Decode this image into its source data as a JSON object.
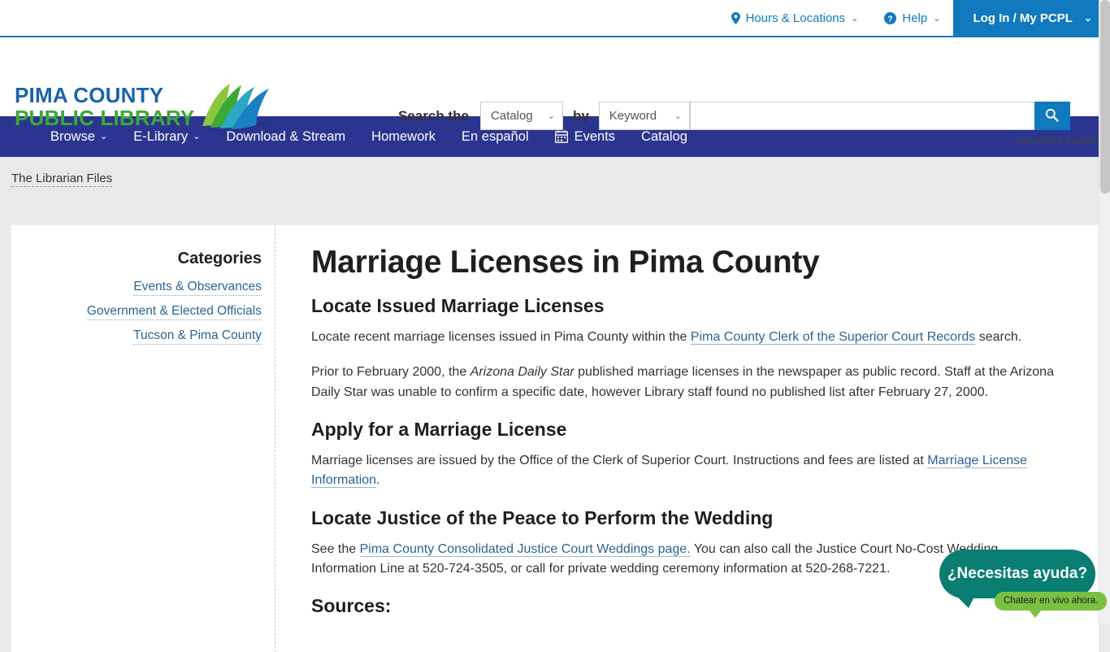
{
  "topbar": {
    "hours_locations": "Hours & Locations",
    "help": "Help",
    "login": "Log In / My PCPL",
    "caret": "⌄"
  },
  "header": {
    "logo_line1": "PIMA COUNTY",
    "logo_line2": "PUBLIC LIBRARY",
    "search_label": "Search the",
    "search_by": "by",
    "scope_value": "Catalog",
    "field_value": "Keyword",
    "search_value": "",
    "search_placeholder": "",
    "advanced_search": "Advanced Search",
    "select_caret": "⌄"
  },
  "nav": {
    "items": [
      {
        "label": "Browse",
        "caret": "⌄",
        "icon": ""
      },
      {
        "label": "E-Library",
        "caret": "⌄",
        "icon": ""
      },
      {
        "label": "Download & Stream",
        "caret": "",
        "icon": ""
      },
      {
        "label": "Homework",
        "caret": "",
        "icon": ""
      },
      {
        "label": "En español",
        "caret": "",
        "icon": ""
      },
      {
        "label": "Events",
        "caret": "",
        "icon": "calendar-icon"
      },
      {
        "label": "Catalog",
        "caret": "",
        "icon": ""
      }
    ]
  },
  "breadcrumb": {
    "label": "The Librarian Files"
  },
  "sidebar": {
    "heading": "Categories",
    "categories": [
      "Events & Observances",
      "Government & Elected Officials",
      "Tucson & Pima County"
    ]
  },
  "article": {
    "title": "Marriage Licenses in Pima County",
    "section1": {
      "heading": "Locate Issued Marriage Licenses",
      "p1_before": "Locate recent marriage licenses issued in Pima County within the ",
      "p1_link": "Pima County Clerk of the Superior Court Records",
      "p1_after": " search.",
      "p2_before": "Prior to February 2000, the ",
      "p2_italic": "Arizona Daily Star",
      "p2_after": " published marriage licenses in the newspaper as public record. Staff at the Arizona Daily Star was unable to confirm a specific date, however Library staff found no published list after February 27, 2000."
    },
    "section2": {
      "heading": "Apply for a Marriage License",
      "p1_before": "Marriage licenses are issued by the Office of the Clerk of Superior Court. Instructions and fees are listed at ",
      "p1_link": "Marriage License Information",
      "p1_after": "."
    },
    "section3": {
      "heading": "Locate Justice of the Peace to Perform the Wedding",
      "p1_before": "See the ",
      "p1_link": "Pima County Consolidated Justice Court Weddings page.",
      "p1_after": "  You can also call the Justice Court No-Cost Wedding Information Line at 520-724-3505, or call for private wedding ceremony information at 520-268-7221."
    },
    "section4": {
      "heading": "Sources:"
    }
  },
  "chat": {
    "title": "¿Necesitas ayuda?",
    "subtitle": "Chatear en vivo ahora."
  },
  "colors": {
    "accent_blue": "#1179bd",
    "nav_blue": "#2b3590",
    "logo_blue": "#1b64ad",
    "logo_green": "#3aa935",
    "link_blue": "#2a6496",
    "chat_teal": "#0a7d72",
    "chat_green": "#7ac143",
    "page_bg": "#e9e9e9"
  }
}
